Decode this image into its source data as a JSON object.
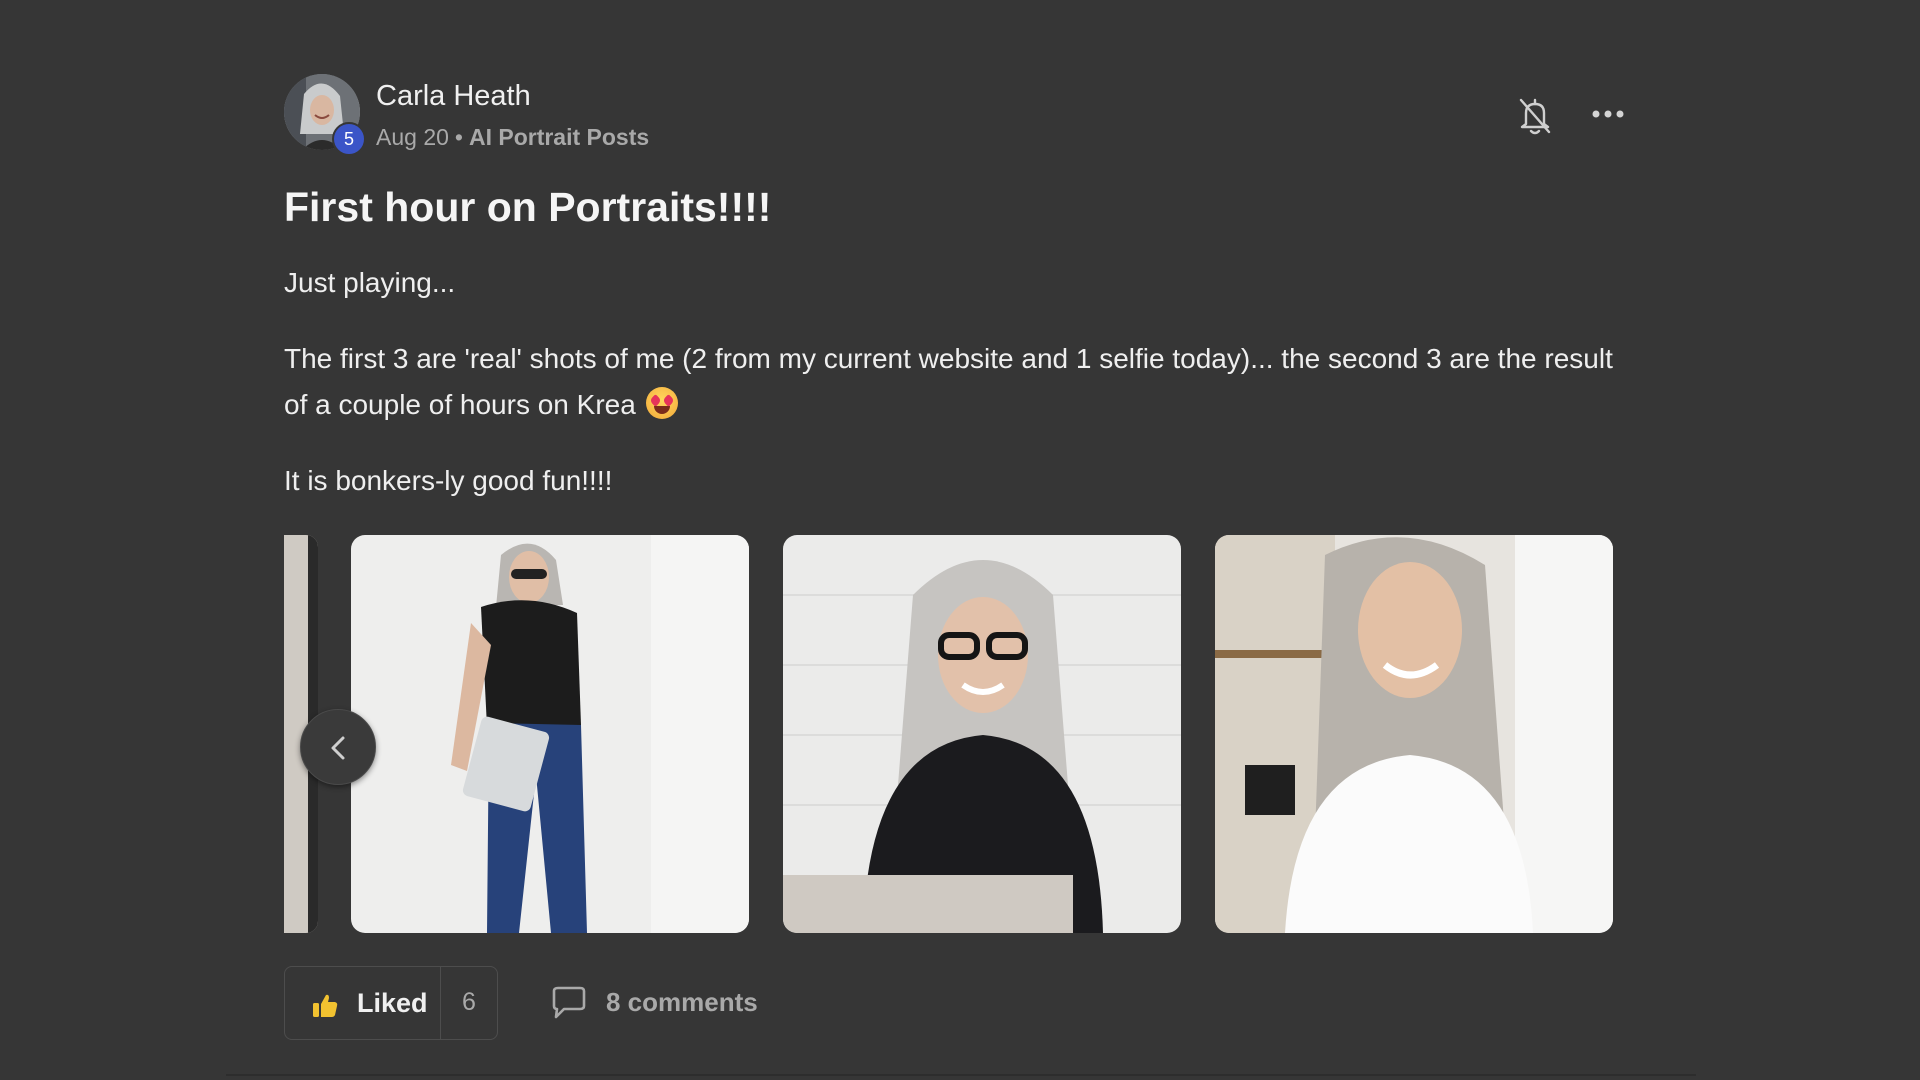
{
  "post": {
    "author": {
      "name": "Carla Heath",
      "level": "5"
    },
    "date": "Aug 20",
    "separator": "•",
    "category": "AI Portrait Posts",
    "title": "First hour on Portraits!!!!",
    "paragraphs": [
      "Just playing...",
      "The first 3 are 'real' shots of me (2 from my current website and 1 selfie today)... the second 3 are the result of a couple of hours on Krea",
      "It is bonkers-ly good fun!!!!"
    ],
    "gallery": {
      "images": [
        {
          "description": "woman-leaning-wall-with-laptop"
        },
        {
          "description": "woman-with-glasses-at-laptop"
        },
        {
          "description": "woman-smiling-white-shirt"
        }
      ]
    },
    "actions": {
      "like_label": "Liked",
      "like_count": "6",
      "comments_label": "8 comments"
    }
  },
  "icons": {
    "bell": "bell-off-icon",
    "more": "more-horizontal-icon",
    "prev": "chevron-left-icon",
    "like": "thumbs-up-icon",
    "comment": "comment-icon"
  },
  "colors": {
    "background": "#363636",
    "level_badge": "#3b55c8",
    "like_icon": "#f2c230",
    "muted_text": "#a9a9a9"
  }
}
